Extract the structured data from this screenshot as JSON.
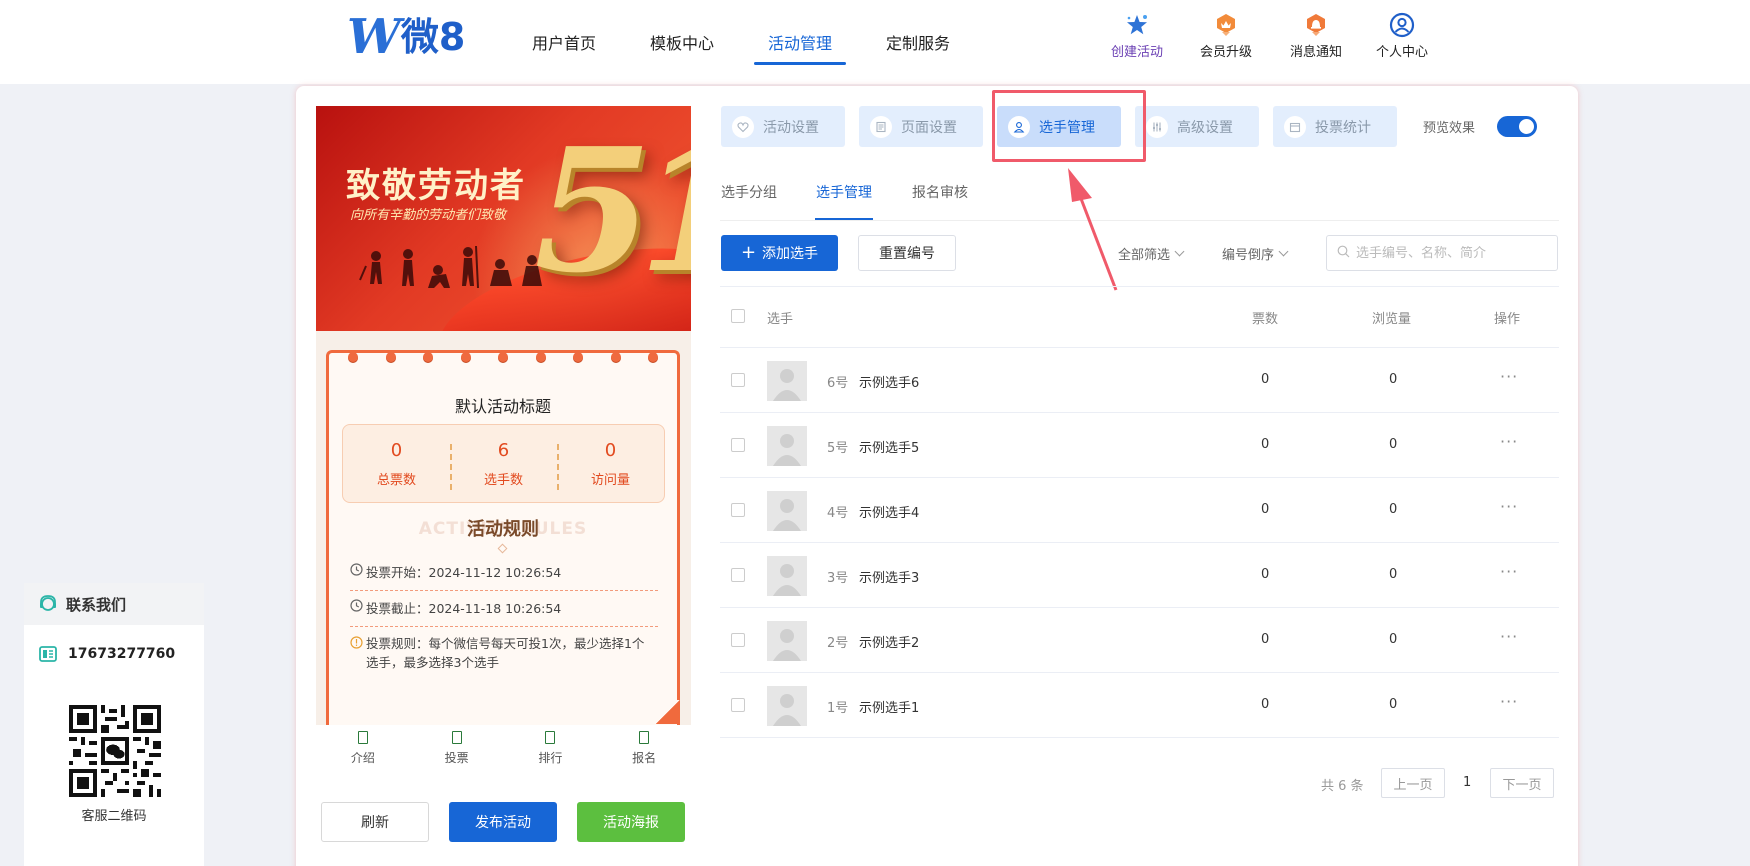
{
  "brand": {
    "logo_mark": "W",
    "name": "微8"
  },
  "nav": [
    {
      "label": "用户首页",
      "active": false
    },
    {
      "label": "模板中心",
      "active": false
    },
    {
      "label": "活动管理",
      "active": true
    },
    {
      "label": "定制服务",
      "active": false
    }
  ],
  "quick_actions": [
    {
      "label": "创建活动",
      "icon": "star-icon"
    },
    {
      "label": "会员升级",
      "icon": "crown-badge-icon"
    },
    {
      "label": "消息通知",
      "icon": "bell-badge-icon"
    },
    {
      "label": "个人中心",
      "icon": "user-circle-icon"
    }
  ],
  "preview": {
    "banner_title": "致敬劳动者",
    "banner_subtitle": "向所有辛勤的劳动者们致敬",
    "banner_number": "51",
    "activity_title": "默认活动标题",
    "stats": [
      {
        "value": "0",
        "label": "总票数"
      },
      {
        "value": "6",
        "label": "选手数"
      },
      {
        "value": "0",
        "label": "访问量"
      }
    ],
    "rules_bg_text": "ACTIVITY RULES",
    "rules_title": "活动规则",
    "vote_start": "投票开始：2024-11-12 10:26:54",
    "vote_end": "投票截止：2024-11-18 10:26:54",
    "vote_rule": "投票规则：每个微信号每天可投1次，最少选择1个选手，最多选择3个选手",
    "tabs": [
      "介绍",
      "投票",
      "排行",
      "报名"
    ],
    "buttons": {
      "refresh": "刷新",
      "publish": "发布活动",
      "poster": "活动海报"
    },
    "colors": {
      "publish": "#1766d6",
      "poster": "#5cbf3f"
    }
  },
  "steps": [
    {
      "label": "活动设置",
      "active": false
    },
    {
      "label": "页面设置",
      "active": false
    },
    {
      "label": "选手管理",
      "active": true
    },
    {
      "label": "高级设置",
      "active": false
    },
    {
      "label": "投票统计",
      "active": false
    }
  ],
  "preview_toggle": {
    "label": "预览效果",
    "on": true
  },
  "subtabs": [
    {
      "label": "选手分组",
      "active": false
    },
    {
      "label": "选手管理",
      "active": true
    },
    {
      "label": "报名审核",
      "active": false
    }
  ],
  "toolbar": {
    "add_label": "添加选手",
    "reset_label": "重置编号",
    "filter_label": "全部筛选",
    "sort_label": "编号倒序",
    "search_placeholder": "选手编号、名称、简介"
  },
  "table": {
    "headers": {
      "player": "选手",
      "votes": "票数",
      "views": "浏览量",
      "actions": "操作"
    },
    "rows": [
      {
        "number": "6号",
        "name": "示例选手6",
        "votes": "0",
        "views": "0"
      },
      {
        "number": "5号",
        "name": "示例选手5",
        "votes": "0",
        "views": "0"
      },
      {
        "number": "4号",
        "name": "示例选手4",
        "votes": "0",
        "views": "0"
      },
      {
        "number": "3号",
        "name": "示例选手3",
        "votes": "0",
        "views": "0"
      },
      {
        "number": "2号",
        "name": "示例选手2",
        "votes": "0",
        "views": "0"
      },
      {
        "number": "1号",
        "name": "示例选手1",
        "votes": "0",
        "views": "0"
      }
    ]
  },
  "pagination": {
    "total": "共 6 条",
    "prev": "上一页",
    "current": "1",
    "next": "下一页"
  },
  "contact": {
    "title": "联系我们",
    "phone": "17673277760",
    "qr_label": "客服二维码"
  },
  "annotation": {
    "highlight_color": "#f05a6a"
  }
}
